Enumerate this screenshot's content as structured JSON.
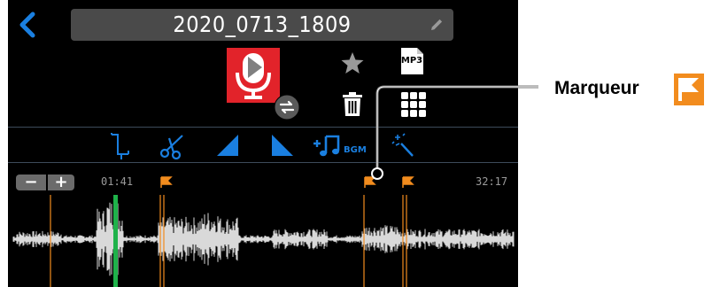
{
  "header": {
    "back_icon": "chevron-left-icon",
    "file_name": "2020_0713_1809",
    "rename_icon": "pencil-icon"
  },
  "file": {
    "icon": "microphone-icon",
    "badge_icon": "sync-icon",
    "favorite_icon": "star-icon",
    "format_label": "MP3",
    "delete_icon": "trash-icon",
    "menu_icon": "grid-icon"
  },
  "edit_toolbar": {
    "tools": [
      {
        "name": "trim-icon"
      },
      {
        "name": "cut-icon"
      },
      {
        "name": "fade-in-icon"
      },
      {
        "name": "fade-out-icon"
      },
      {
        "name": "add-bgm-icon",
        "label": "+",
        "sub": "BGM"
      },
      {
        "name": "effect-wand-icon"
      }
    ]
  },
  "timeline": {
    "zoom_out": "−",
    "zoom_in": "+",
    "current_time": "01:41",
    "total_time": "32:17",
    "playhead_color": "#1fb24a",
    "marker_color": "#f28c1e"
  },
  "annotation": {
    "label": "Marqueur"
  },
  "colors": {
    "accent": "#1a7fe0",
    "file_red": "#e2232a",
    "marker_orange": "#f28c1e"
  }
}
